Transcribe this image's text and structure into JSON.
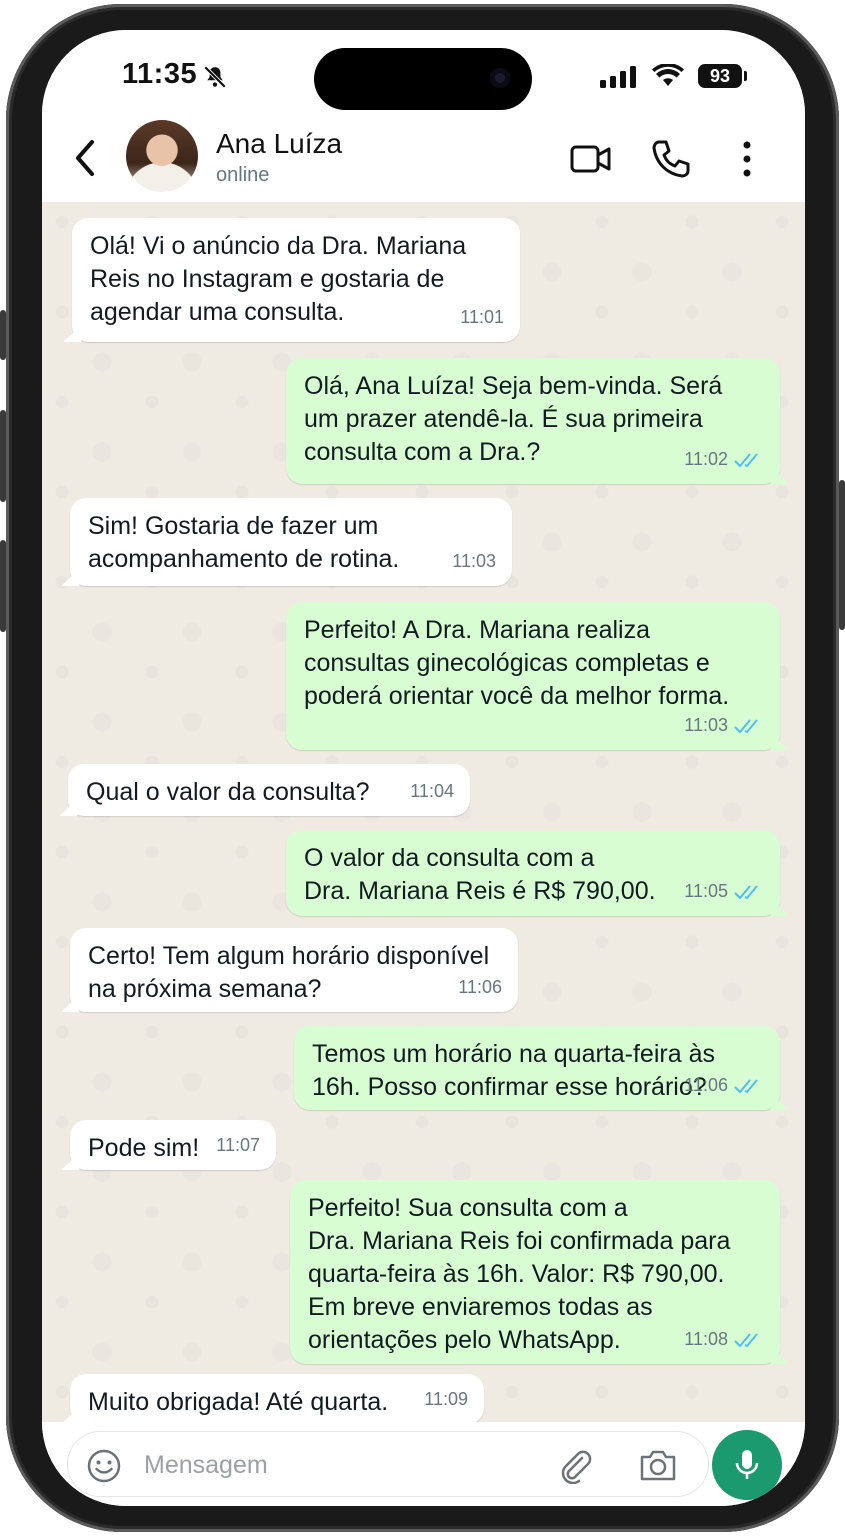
{
  "status_bar": {
    "time": "11:35",
    "battery": "93",
    "icons": [
      "bell-muted-icon",
      "signal-icon",
      "wifi-icon",
      "battery-icon"
    ]
  },
  "header": {
    "contact_name": "Ana Luíza",
    "contact_status": "online",
    "icons": [
      "back-icon",
      "video-call-icon",
      "phone-icon",
      "more-options-icon"
    ]
  },
  "colors": {
    "incoming": "#ffffff",
    "outgoing": "#d9fdd3",
    "chat_bg": "#efeae2",
    "accent": "#1a9a6e",
    "read_ticks": "#53bdeb"
  },
  "messages": [
    {
      "direction": "in",
      "text": "Olá! Vi o anúncio da Dra. Mariana\nReis no Instagram e gostaria de\nagendar uma consulta.",
      "time": "11:01"
    },
    {
      "direction": "out",
      "text": "Olá, Ana Luíza! Seja bem-vinda. Será\num prazer atendê-la. É sua primeira\nconsulta com a Dra.?",
      "time": "11:02",
      "status": "read"
    },
    {
      "direction": "in",
      "text": "Sim! Gostaria de fazer um\nacompanhamento de rotina.",
      "time": "11:03"
    },
    {
      "direction": "out",
      "text": "Perfeito! A Dra. Mariana realiza\nconsultas ginecológicas completas e\npoderá orientar você da melhor forma.",
      "time": "11:03",
      "status": "read"
    },
    {
      "direction": "in",
      "text": "Qual o valor da consulta?",
      "time": "11:04"
    },
    {
      "direction": "out",
      "text": "O valor da consulta com a\nDra. Mariana Reis é R$ 790,00.",
      "time": "11:05",
      "status": "read"
    },
    {
      "direction": "in",
      "text": "Certo! Tem algum horário disponível\nna próxima semana?",
      "time": "11:06"
    },
    {
      "direction": "out",
      "text": "Temos um horário na quarta-feira às\n16h. Posso confirmar esse horário?",
      "time": "11:06",
      "status": "read"
    },
    {
      "direction": "in",
      "text": "Pode sim!",
      "time": "11:07"
    },
    {
      "direction": "out",
      "text": "Perfeito! Sua consulta com a\nDra. Mariana Reis foi confirmada para\nquarta-feira às 16h. Valor: R$ 790,00.\nEm breve enviaremos todas as\norientações pelo WhatsApp.",
      "time": "11:08",
      "status": "read"
    },
    {
      "direction": "in",
      "text": "Muito obrigada! Até quarta.",
      "time": "11:09"
    }
  ],
  "input": {
    "placeholder": "Mensagem",
    "icons": [
      "emoji-icon",
      "attach-icon",
      "camera-icon",
      "mic-icon"
    ]
  }
}
